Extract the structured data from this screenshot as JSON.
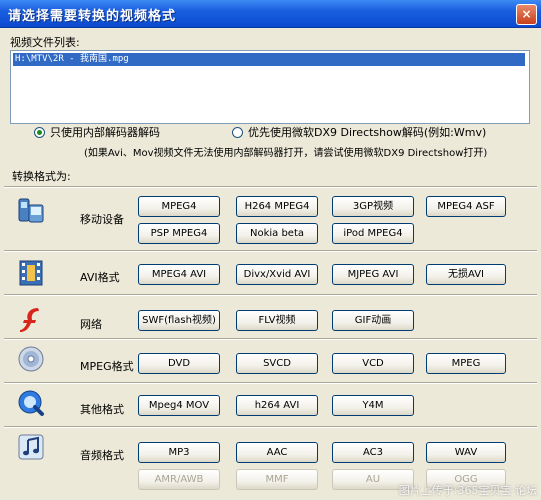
{
  "window": {
    "title": "请选择需要转换的视频格式",
    "close_glyph": "×"
  },
  "file_list": {
    "label": "视频文件列表:",
    "items": [
      "H:\\MTV\\2R - 我南国.mpg"
    ]
  },
  "decoder": {
    "option_internal": "只使用内部解码器解码",
    "option_directshow": "优先使用微软DX9 Directshow解码(例如:Wmv)",
    "selected": "internal",
    "note": "(如果Avi、Mov视频文件无法使用内部解码器打开，请尝试使用微软DX9 Directshow打开)"
  },
  "convert_label": "转换格式为:",
  "categories": [
    {
      "label": "移动设备",
      "icon": "mobile-device-icon",
      "buttons": [
        "MPEG4",
        "H264 MPEG4",
        "3GP视频",
        "MPEG4 ASF",
        "PSP MPEG4",
        "Nokia beta",
        "iPod MPEG4"
      ]
    },
    {
      "label": "AVI格式",
      "icon": "film-strip-icon",
      "buttons": [
        "MPEG4 AVI",
        "Divx/Xvid AVI",
        "MJPEG AVI",
        "无损AVI"
      ]
    },
    {
      "label": "网络",
      "icon": "flash-icon",
      "buttons": [
        "SWF(flash视频)",
        "FLV视频",
        "GIF动画"
      ]
    },
    {
      "label": "MPEG格式",
      "icon": "disc-icon",
      "buttons": [
        "DVD",
        "SVCD",
        "VCD",
        "MPEG"
      ]
    },
    {
      "label": "其他格式",
      "icon": "quicktime-icon",
      "buttons": [
        "Mpeg4 MOV",
        "h264 AVI",
        "Y4M"
      ]
    },
    {
      "label": "音频格式",
      "icon": "music-note-icon",
      "buttons": [
        "MP3",
        "AAC",
        "AC3",
        "WAV",
        "AMR/AWB",
        "MMF",
        "AU",
        "OGG"
      ]
    }
  ],
  "watermark": "图片上传于:365宝贝宝·论坛"
}
